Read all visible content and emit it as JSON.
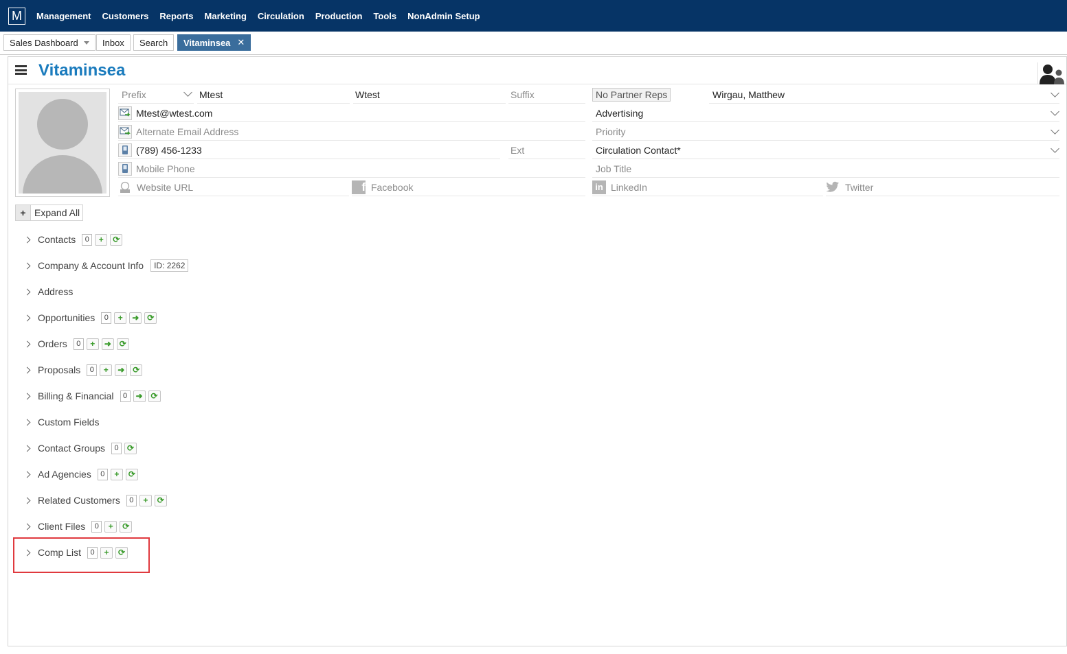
{
  "app": {
    "logo": "M"
  },
  "nav": [
    "Management",
    "Customers",
    "Reports",
    "Marketing",
    "Circulation",
    "Production",
    "Tools",
    "NonAdmin Setup"
  ],
  "tabs": {
    "sales_dashboard": "Sales Dashboard",
    "inbox": "Inbox",
    "search": "Search",
    "active": "Vitaminsea",
    "close": "✕"
  },
  "page": {
    "title": "Vitaminsea"
  },
  "contact": {
    "prefix_placeholder": "Prefix",
    "first_name": "Mtest",
    "last_name": "Wtest",
    "suffix_placeholder": "Suffix",
    "partner_reps": "No Partner Reps",
    "rep": "Wirgau, Matthew",
    "email": "Mtest@wtest.com",
    "alt_email_placeholder": "Alternate Email Address",
    "phone": "(789) 456-1233",
    "ext_placeholder": "Ext",
    "mobile_placeholder": "Mobile Phone",
    "website_placeholder": "Website URL",
    "facebook_placeholder": "Facebook",
    "linkedin_placeholder": "LinkedIn",
    "twitter_placeholder": "Twitter",
    "type": "Advertising",
    "priority_placeholder": "Priority",
    "circulation": "Circulation Contact*",
    "job_title_placeholder": "Job Title"
  },
  "expand_all": {
    "icon": "+",
    "label": "Expand All"
  },
  "sections": {
    "contacts": {
      "label": "Contacts",
      "count": "0"
    },
    "company": {
      "label": "Company & Account Info",
      "id": "ID: 2262"
    },
    "address": {
      "label": "Address"
    },
    "opportunities": {
      "label": "Opportunities",
      "count": "0"
    },
    "orders": {
      "label": "Orders",
      "count": "0"
    },
    "proposals": {
      "label": "Proposals",
      "count": "0"
    },
    "billing": {
      "label": "Billing & Financial",
      "count": "0"
    },
    "custom_fields": {
      "label": "Custom Fields"
    },
    "contact_groups": {
      "label": "Contact Groups",
      "count": "0"
    },
    "ad_agencies": {
      "label": "Ad Agencies",
      "count": "0"
    },
    "related_customers": {
      "label": "Related Customers",
      "count": "0"
    },
    "client_files": {
      "label": "Client Files",
      "count": "0"
    },
    "comp_list": {
      "label": "Comp List",
      "count": "0"
    }
  },
  "colors": {
    "nav_bg": "#063466",
    "title": "#1a7bbd",
    "active_tab": "#3a6d9c",
    "highlight": "#e0393e",
    "action_green": "#3a9b2b"
  }
}
